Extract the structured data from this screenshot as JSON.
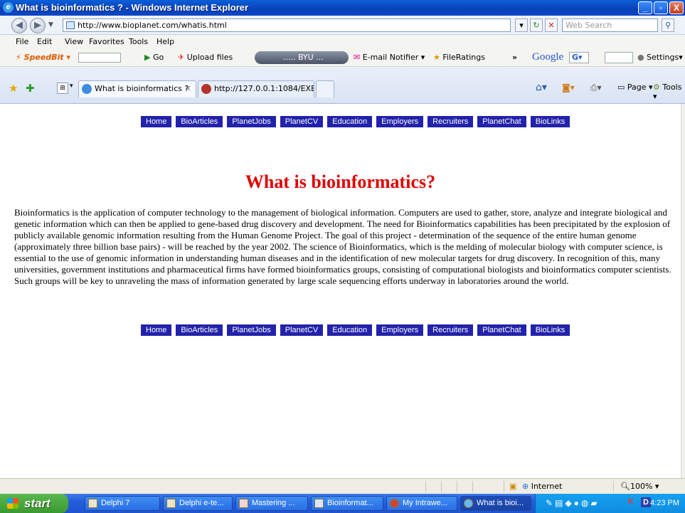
{
  "window": {
    "title": "What is bioinformatics ? - Windows Internet Explorer",
    "min": "_",
    "max": "▫",
    "close": "X"
  },
  "address": {
    "url": "http://www.bioplanet.com/whatis.html",
    "search_placeholder": "Web Search"
  },
  "menu": [
    "File",
    "Edit",
    "View",
    "Favorites",
    "Tools",
    "Help"
  ],
  "toolbar": {
    "speedbit": "SpeedBit",
    "go": "Go",
    "upload": "Upload files",
    "byu": "..... BYU ...",
    "email": "E-mail Notifier",
    "fileratings": "FileRatings",
    "google": "Google",
    "settings": "Settings"
  },
  "tabs": [
    {
      "label": "What is bioinformatics ?"
    },
    {
      "label": "http://127.0.0.1:1084/EXEC..."
    }
  ],
  "cmdbar": {
    "page": "Page",
    "tools": "Tools"
  },
  "page": {
    "nav": [
      "Home",
      "BioArticles",
      "PlanetJobs",
      "PlanetCV",
      "Education",
      "Employers",
      "Recruiters",
      "PlanetChat",
      "BioLinks"
    ],
    "heading": "What is bioinformatics?",
    "body": "Bioinformatics is the application of computer technology to the management of biological information. Computers are used to gather, store, analyze and integrate biological and genetic information which can then be applied to gene-based drug discovery and development. The need for Bioinformatics capabilities has been precipitated by the explosion of publicly available genomic information resulting from the Human Genome Project. The goal of this project - determination of the sequence of the entire human genome (approximately three billion base pairs) - will be reached by the year 2002. The science of Bioinformatics, which is the melding of molecular biology with computer science, is essential to the use of genomic information in understanding human diseases and in the identification of new molecular targets for drug discovery. In recognition of this, many universities, government institutions and pharmaceutical firms have formed bioinformatics groups, consisting of computational biologists and bioinformatics computer scientists. Such groups will be key to unraveling the mass of information generated by large scale sequencing efforts underway in laboratories around the world."
  },
  "status": {
    "zone": "Internet",
    "zoom": "100%"
  },
  "taskbar": {
    "start": "start",
    "tasks": [
      {
        "label": "Delphi 7",
        "active": false
      },
      {
        "label": "Delphi e-te...",
        "active": false
      },
      {
        "label": "Mastering ...",
        "active": false
      },
      {
        "label": "Bioinformat...",
        "active": false
      },
      {
        "label": "My Intrawe...",
        "active": false
      },
      {
        "label": "What is bioi...",
        "active": true
      }
    ],
    "clock": "4:23 PM"
  }
}
